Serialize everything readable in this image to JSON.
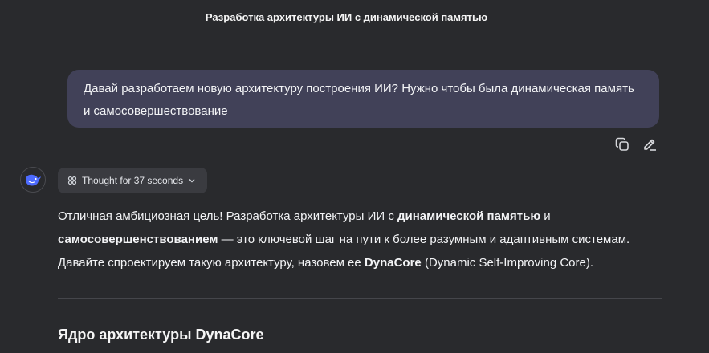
{
  "header": {
    "title": "Разработка архитектуры ИИ с динамической памятью"
  },
  "user_message": {
    "text": "Давай разработаем новую архитектуру построения ИИ? Нужно чтобы была динамическая память и самосовершествование"
  },
  "message_actions": {
    "icons": [
      "copy-icon",
      "edit-icon"
    ]
  },
  "assistant": {
    "avatar_icon": "deepseek-whale-icon",
    "thought_label": "Thought for 37 seconds",
    "paragraph": {
      "p1": "Отличная амбициозная цель! Разработка архитектуры ИИ с ",
      "b1": "динамической памятью",
      "p2": " и ",
      "b2": "самосовершенствованием",
      "p3": " — это ключевой шаг на пути к более разумным и адаптивным системам. Давайте спроектируем такую архитектуру, назовем ее ",
      "b3": "DynaCore",
      "p4": " (Dynamic Self-Improving Core)."
    },
    "section_heading": "Ядро архитектуры DynaCore"
  },
  "colors": {
    "background": "#292a2d",
    "user_bubble": "#414158",
    "pill": "#3a3b40",
    "accent": "#4d6bfe"
  }
}
